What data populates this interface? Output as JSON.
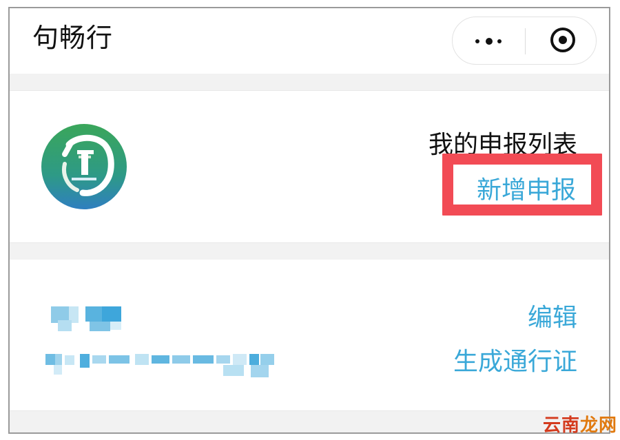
{
  "navbar": {
    "title": "句畅行",
    "more_icon": "more-dots-icon",
    "close_icon": "target-icon"
  },
  "header": {
    "logo_icon": "app-logo-icon",
    "list_title": "我的申报列表",
    "add_label": "新增申报"
  },
  "record": {
    "name": "",
    "id_number": "",
    "edit_label": "编辑",
    "pass_label": "生成通行证"
  },
  "watermark": {
    "c1": "云",
    "c2": "南",
    "c3": "龙",
    "c4": "网"
  },
  "colors": {
    "accent_link": "#3aa8d8",
    "highlight": "#f24b55",
    "logo_green": "#3aa65a",
    "logo_blue": "#2f7fc0"
  }
}
